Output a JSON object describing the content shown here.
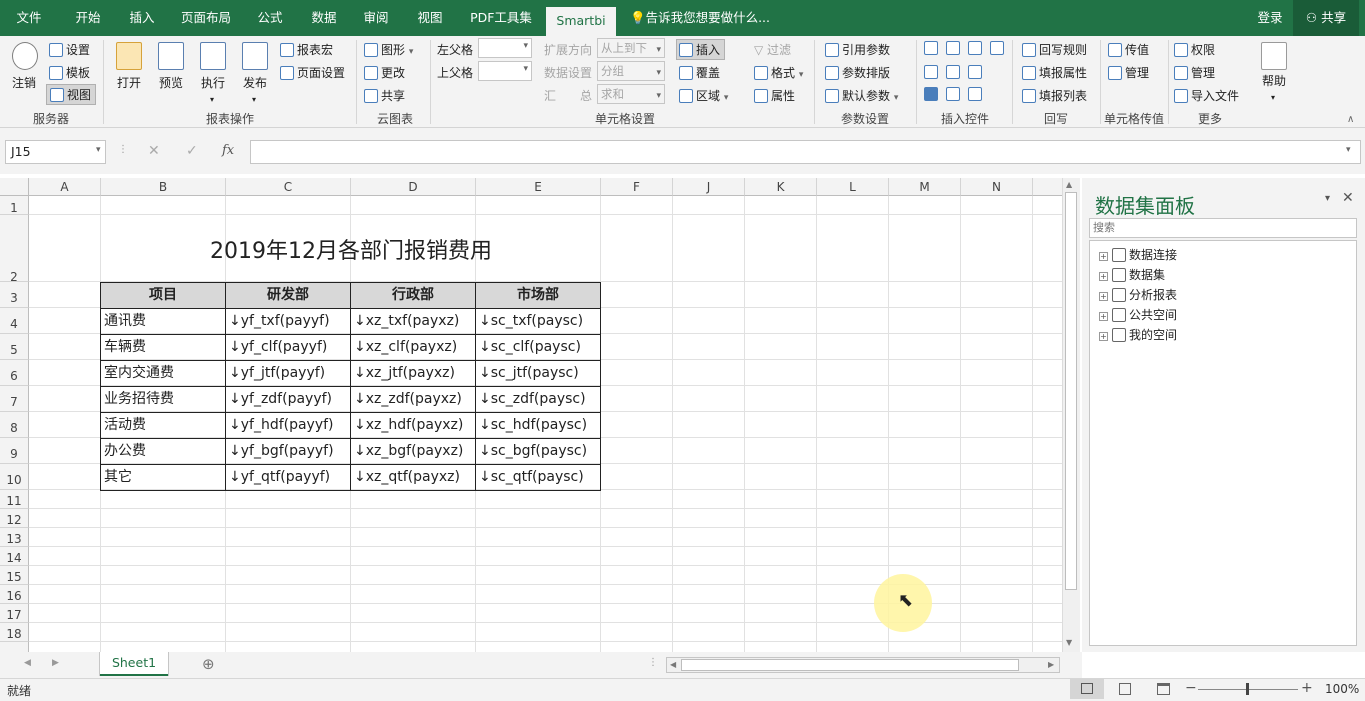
{
  "menu": {
    "tabs": [
      "文件",
      "开始",
      "插入",
      "页面布局",
      "公式",
      "数据",
      "审阅",
      "视图",
      "PDF工具集",
      "Smartbi"
    ],
    "active_tab": "Smartbi",
    "tell_me": "告诉我您想要做什么...",
    "login": "登录",
    "share": "共享"
  },
  "ribbon": {
    "server": {
      "logout": "注销",
      "settings": "设置",
      "template": "模板",
      "view": "视图",
      "group": "服务器"
    },
    "report_ops": {
      "open": "打开",
      "preview": "预览",
      "execute": "执行",
      "publish": "发布",
      "macro": "报表宏",
      "page_setup": "页面设置",
      "group": "报表操作"
    },
    "cloud": {
      "graphic": "图形",
      "modify": "更改",
      "share": "共享",
      "group": "云图表"
    },
    "cell_settings": {
      "left_parent": "左父格",
      "up_parent": "上父格",
      "expand_dir": "扩展方向",
      "expand_val": "从上到下",
      "data_setting": "数据设置",
      "data_val": "分组",
      "summary": "汇　　总",
      "summary_val": "求和",
      "insert": "插入",
      "cover": "覆盖",
      "area": "区域",
      "filter": "过滤",
      "format": "格式",
      "property": "属性",
      "group": "单元格设置"
    },
    "params": {
      "ref": "引用参数",
      "layout": "参数排版",
      "default": "默认参数",
      "group": "参数设置"
    },
    "insert_controls": {
      "group": "插入控件"
    },
    "writeback": {
      "rule": "回写规则",
      "fill_prop": "填报属性",
      "fill_list": "填报列表",
      "group": "回写"
    },
    "cell_pass": {
      "pass": "传值",
      "manage": "管理",
      "group": "单元格传值"
    },
    "more": {
      "perm": "权限",
      "manage": "管理",
      "import": "导入文件",
      "help": "帮助",
      "group": "更多"
    }
  },
  "formula_bar": {
    "name_box": "J15",
    "cancel": "✕",
    "confirm": "✓",
    "fx": "fx",
    "formula": ""
  },
  "sheet": {
    "columns": [
      "A",
      "B",
      "C",
      "D",
      "E",
      "F",
      "J",
      "K",
      "L",
      "M",
      "N"
    ],
    "rows": [
      "1",
      "2",
      "3",
      "4",
      "5",
      "6",
      "7",
      "8",
      "9",
      "10",
      "11",
      "12",
      "13",
      "14",
      "15",
      "16",
      "17",
      "18"
    ],
    "title": "2019年12月各部门报销费用",
    "table": {
      "headers": [
        "项目",
        "研发部",
        "行政部",
        "市场部"
      ],
      "rows": [
        [
          "通讯费",
          "↓yf_txf(payyf)",
          "↓xz_txf(payxz)",
          "↓sc_txf(paysc)"
        ],
        [
          "车辆费",
          "↓yf_clf(payyf)",
          "↓xz_clf(payxz)",
          "↓sc_clf(paysc)"
        ],
        [
          "室内交通费",
          "↓yf_jtf(payyf)",
          "↓xz_jtf(payxz)",
          "↓sc_jtf(paysc)"
        ],
        [
          "业务招待费",
          "↓yf_zdf(payyf)",
          "↓xz_zdf(payxz)",
          "↓sc_zdf(paysc)"
        ],
        [
          "活动费",
          "↓yf_hdf(payyf)",
          "↓xz_hdf(payxz)",
          "↓sc_hdf(paysc)"
        ],
        [
          "办公费",
          "↓yf_bgf(payyf)",
          "↓xz_bgf(payxz)",
          "↓sc_bgf(paysc)"
        ],
        [
          "其它",
          "↓yf_qtf(payyf)",
          "↓xz_qtf(payxz)",
          "↓sc_qtf(paysc)"
        ]
      ]
    }
  },
  "panel": {
    "title": "数据集面板",
    "search_placeholder": "搜索",
    "items": [
      "数据连接",
      "数据集",
      "分析报表",
      "公共空间",
      "我的空间"
    ]
  },
  "sheet_tabs": {
    "active": "Sheet1",
    "add": "⊕"
  },
  "status": {
    "text": "就绪",
    "zoom": "100%",
    "minus": "−",
    "plus": "+"
  },
  "colors": {
    "brand": "#217346",
    "highlight": "#fff59d"
  }
}
